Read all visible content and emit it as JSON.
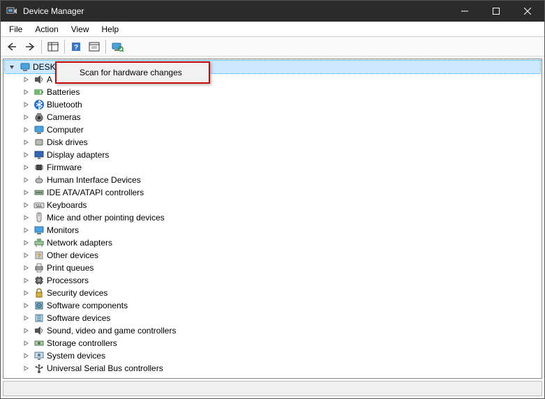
{
  "window": {
    "title": "Device Manager"
  },
  "menu": {
    "file": "File",
    "action": "Action",
    "view": "View",
    "help": "Help"
  },
  "contextMenu": {
    "item0": "Scan for hardware changes"
  },
  "tree": {
    "root": {
      "label": "DESKT"
    },
    "categories": [
      {
        "label": "A",
        "icon": "sound"
      },
      {
        "label": "Batteries",
        "icon": "battery"
      },
      {
        "label": "Bluetooth",
        "icon": "bluetooth"
      },
      {
        "label": "Cameras",
        "icon": "camera"
      },
      {
        "label": "Computer",
        "icon": "computer"
      },
      {
        "label": "Disk drives",
        "icon": "disk"
      },
      {
        "label": "Display adapters",
        "icon": "display"
      },
      {
        "label": "Firmware",
        "icon": "chip"
      },
      {
        "label": "Human Interface Devices",
        "icon": "hid"
      },
      {
        "label": "IDE ATA/ATAPI controllers",
        "icon": "ide"
      },
      {
        "label": "Keyboards",
        "icon": "keyboard"
      },
      {
        "label": "Mice and other pointing devices",
        "icon": "mouse"
      },
      {
        "label": "Monitors",
        "icon": "monitor"
      },
      {
        "label": "Network adapters",
        "icon": "network"
      },
      {
        "label": "Other devices",
        "icon": "other"
      },
      {
        "label": "Print queues",
        "icon": "printer"
      },
      {
        "label": "Processors",
        "icon": "cpu"
      },
      {
        "label": "Security devices",
        "icon": "security"
      },
      {
        "label": "Software components",
        "icon": "softcomp"
      },
      {
        "label": "Software devices",
        "icon": "softdev"
      },
      {
        "label": "Sound, video and game controllers",
        "icon": "sound"
      },
      {
        "label": "Storage controllers",
        "icon": "storage"
      },
      {
        "label": "System devices",
        "icon": "system"
      },
      {
        "label": "Universal Serial Bus controllers",
        "icon": "usb"
      }
    ]
  }
}
